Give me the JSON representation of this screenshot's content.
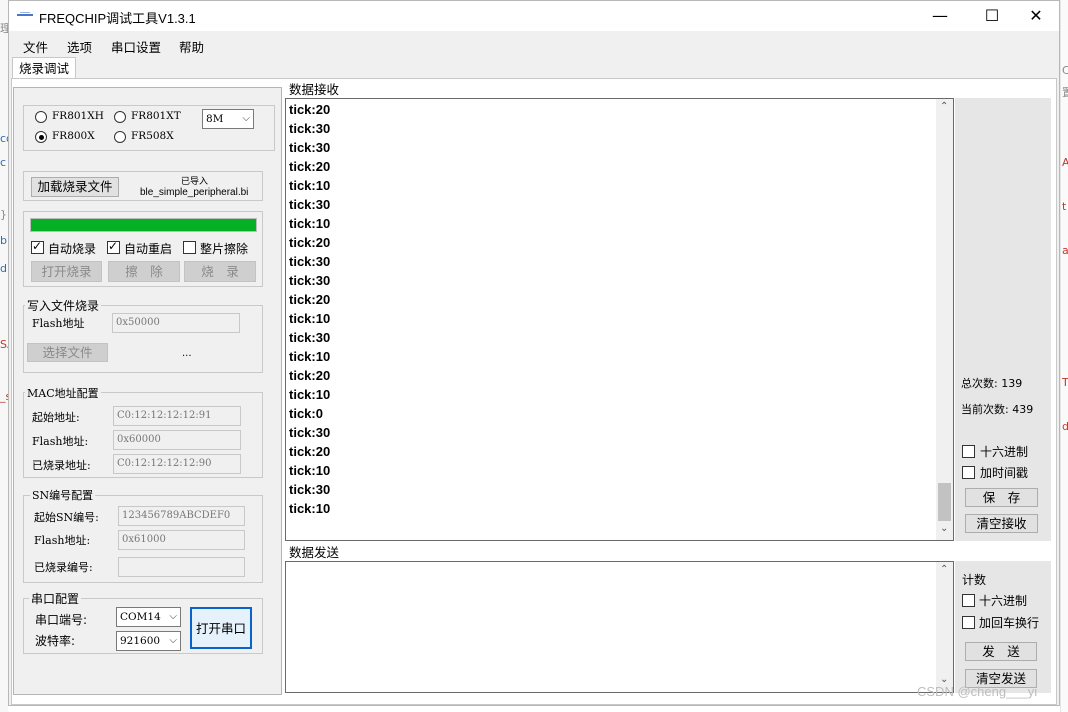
{
  "window": {
    "title": "FREQCHIP调试工具V1.3.1",
    "minimize_glyph": "—",
    "maximize_glyph": "☐",
    "close_glyph": "✕"
  },
  "menu": [
    "文件",
    "选项",
    "串口设置",
    "帮助"
  ],
  "tabs": [
    "烧录调试"
  ],
  "chip_select": {
    "options": [
      {
        "label": "FR801XH",
        "selected": false
      },
      {
        "label": "FR801XT",
        "selected": false
      },
      {
        "label": "FR800X",
        "selected": true
      },
      {
        "label": "FR508X",
        "selected": false
      }
    ],
    "flash_size": "8M"
  },
  "load_file": {
    "button_label": "加载烧录文件",
    "status": "已导入",
    "file_name": "ble_simple_peripheral.bi"
  },
  "burn": {
    "progress": 1.0,
    "progress_color": "#06b025",
    "auto_burn": {
      "label": "自动烧录",
      "checked": true
    },
    "auto_restart": {
      "label": "自动重启",
      "checked": true
    },
    "full_erase": {
      "label": "整片擦除",
      "checked": false
    },
    "open_burn_label": "打开烧录",
    "erase_label": "擦　除",
    "burn_label": "烧　录"
  },
  "write_file": {
    "title": "写入文件烧录",
    "flash_addr_label": "Flash地址",
    "flash_addr_value": "0x50000",
    "select_file_label": "选择文件",
    "file_placeholder": "..."
  },
  "mac_config": {
    "title": "MAC地址配置",
    "start_label": "起始地址:",
    "start_value": "C0:12:12:12:12:91",
    "flash_label": "Flash地址:",
    "flash_value": "0x60000",
    "burned_label": "已烧录地址:",
    "burned_value": "C0:12:12:12:12:90"
  },
  "sn_config": {
    "title": "SN编号配置",
    "start_label": "起始SN编号:",
    "start_value": "123456789ABCDEF0",
    "flash_label": "Flash地址:",
    "flash_value": "0x61000",
    "burned_label": "已烧录编号:",
    "burned_value": ""
  },
  "serial": {
    "title": "串口配置",
    "port_label": "串口端号:",
    "port_value": "COM14",
    "baud_label": "波特率:",
    "baud_value": "921600",
    "open_label": "打开串口"
  },
  "receive": {
    "title": "数据接收",
    "lines": [
      "tick:20",
      "tick:30",
      "tick:30",
      "tick:20",
      "tick:10",
      "tick:30",
      "tick:10",
      "tick:20",
      "tick:30",
      "tick:30",
      "tick:20",
      "tick:10",
      "tick:30",
      "tick:10",
      "tick:20",
      "tick:10",
      "tick:0",
      "tick:30",
      "tick:20",
      "tick:10",
      "tick:30",
      "tick:10"
    ],
    "total_count": "总次数: 139",
    "current_count": "当前次数: 439",
    "hex_label": "十六进制",
    "hex_checked": false,
    "timestamp_label": "加时间戳",
    "timestamp_checked": false,
    "save_label": "保　存",
    "clear_label": "清空接收"
  },
  "send": {
    "title": "数据发送",
    "count_label": "计数",
    "hex_label": "十六进制",
    "hex_checked": false,
    "crlf_label": "加回车换行",
    "crlf_checked": false,
    "send_label": "发　送",
    "clear_label": "清空发送"
  },
  "background_glyphs": {
    "left": [
      "理",
      "co",
      "c",
      "}",
      "b",
      "d",
      "SA",
      "_s"
    ],
    "right": [
      "C",
      "置",
      "A",
      "t",
      "a",
      "T",
      "d"
    ]
  },
  "watermark": "CSDN @cheng___yi"
}
